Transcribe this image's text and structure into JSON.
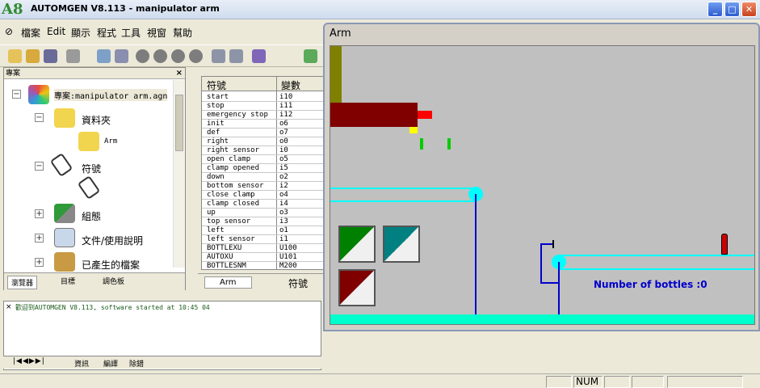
{
  "window": {
    "app_logo": "A8",
    "title": "AUTOMGEN V8.113 - manipulator arm"
  },
  "menu": [
    "檔案",
    "Edit",
    "顯示",
    "程式",
    "工具",
    "視窗",
    "幫助"
  ],
  "project": {
    "header": "專案",
    "close": "×",
    "tree": [
      {
        "label": "專案:manipulator arm.agn"
      },
      {
        "label": "資料夾"
      },
      {
        "label": "Arm"
      },
      {
        "label": "符號"
      },
      {
        "label": ""
      },
      {
        "label": "組態"
      },
      {
        "label": "文件/使用說明"
      },
      {
        "label": "已產生的檔案"
      }
    ],
    "tabs": [
      "瀏覽器",
      "目標",
      "調色板"
    ]
  },
  "symbols": {
    "headers": [
      "符號",
      "變數"
    ],
    "rows": [
      [
        "start",
        "i10"
      ],
      [
        "stop",
        "i11"
      ],
      [
        "emergency stop",
        "i12"
      ],
      [
        "init",
        "o6"
      ],
      [
        "def",
        "o7"
      ],
      [
        "right",
        "o0"
      ],
      [
        "right sensor",
        "i0"
      ],
      [
        "open clamp",
        "o5"
      ],
      [
        "clamp opened",
        "i5"
      ],
      [
        "down",
        "o2"
      ],
      [
        "bottom sensor",
        "i2"
      ],
      [
        "close clamp",
        "o4"
      ],
      [
        "clamp closed",
        "i4"
      ],
      [
        "up",
        "o3"
      ],
      [
        "top sensor",
        "i3"
      ],
      [
        "left",
        "o1"
      ],
      [
        "left sensor",
        "i1"
      ],
      [
        "BOTTLEXU",
        "U100"
      ],
      [
        "AUTOXU",
        "U101"
      ],
      [
        "BOTTLESNM",
        "M200"
      ]
    ],
    "tabs": [
      "Arm",
      "符號"
    ]
  },
  "arm_window": {
    "title": "Arm",
    "counter_text": "Number of bottles :0"
  },
  "messages": {
    "line": "歡迎到AUTOMGEN V8.113, software started at 10:45 04",
    "tabs": [
      "資訊",
      "編譯",
      "除錯"
    ]
  },
  "status": {
    "num": "NUM"
  },
  "colors": {
    "title_gradient": "#cfdcee",
    "canvas_bg": "#c0c0c0",
    "rail": "#00ffff",
    "floor": "#00ffcc",
    "arm": "#800000",
    "text_blue": "#0000cc"
  }
}
